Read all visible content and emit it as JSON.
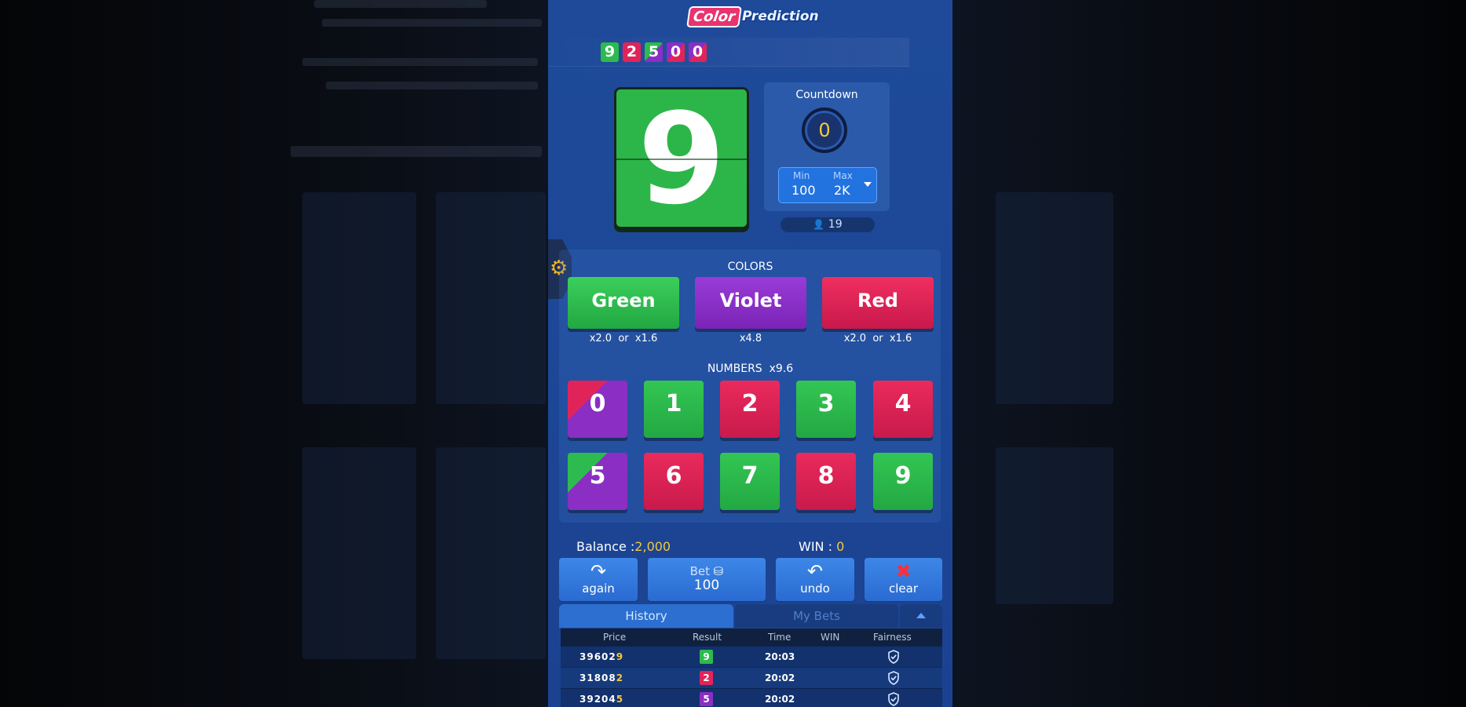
{
  "header": {
    "logo_part1": "Color",
    "logo_part2": "Prediction"
  },
  "recent_results": [
    {
      "digit": "9",
      "color": "green"
    },
    {
      "digit": "2",
      "color": "red"
    },
    {
      "digit": "5",
      "color": "green-violet"
    },
    {
      "digit": "0",
      "color": "red-violet"
    },
    {
      "digit": "0",
      "color": "red-violet"
    }
  ],
  "current_result": {
    "digit": "9",
    "color": "#2cb64a"
  },
  "countdown": {
    "title": "Countdown",
    "value": "0"
  },
  "limits": {
    "min_label": "Min",
    "min_value": "100",
    "max_label": "Max",
    "max_value": "2K"
  },
  "players": {
    "icon": "person-icon",
    "count": "19"
  },
  "colors_section": {
    "title": "COLORS",
    "buttons": [
      {
        "label": "Green",
        "odds": "x2.0  or  x1.6",
        "color": "#2db74d"
      },
      {
        "label": "Violet",
        "odds": "x4.8",
        "color": "#8a2ec6"
      },
      {
        "label": "Red",
        "odds": "x2.0  or  x1.6",
        "color": "#dd2256"
      }
    ]
  },
  "numbers_section": {
    "title": "NUMBERS  x9.6",
    "numbers": [
      {
        "label": "0",
        "style": "red-violet"
      },
      {
        "label": "1",
        "style": "green"
      },
      {
        "label": "2",
        "style": "red"
      },
      {
        "label": "3",
        "style": "green"
      },
      {
        "label": "4",
        "style": "red"
      },
      {
        "label": "5",
        "style": "green-violet"
      },
      {
        "label": "6",
        "style": "red"
      },
      {
        "label": "7",
        "style": "green"
      },
      {
        "label": "8",
        "style": "red"
      },
      {
        "label": "9",
        "style": "green"
      }
    ]
  },
  "wallet": {
    "balance_label": "Balance :",
    "balance_value": "2,000",
    "win_label": "WIN :",
    "win_value": "0"
  },
  "actions": {
    "again": "again",
    "bet_label": "Bet",
    "bet_value": "100",
    "undo": "undo",
    "clear": "clear"
  },
  "tabs": {
    "history": "History",
    "my_bets": "My Bets"
  },
  "history_table": {
    "headers": [
      "Price",
      "Result",
      "Time",
      "WIN",
      "Fairness"
    ],
    "rows": [
      {
        "price_prefix": "39602",
        "price_last": "9",
        "result": "9",
        "result_color": "green",
        "time": "20:03"
      },
      {
        "price_prefix": "31808",
        "price_last": "2",
        "result": "2",
        "result_color": "red",
        "time": "20:02"
      },
      {
        "price_prefix": "39204",
        "price_last": "5",
        "result": "5",
        "result_color": "violet",
        "time": "20:02"
      }
    ]
  }
}
